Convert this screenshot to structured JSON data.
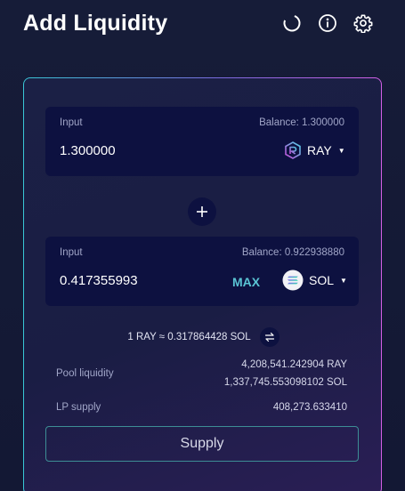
{
  "header": {
    "title": "Add Liquidity"
  },
  "colors": {
    "background": "#141a33",
    "panel": "#0d1140",
    "accent_teal": "#5ac4d4",
    "accent_purple": "#d35fe6",
    "muted_text": "#a1a6c8"
  },
  "icons": {
    "refresh": "refresh-icon",
    "info": "info-icon",
    "settings": "gear-icon"
  },
  "input_a": {
    "label": "Input",
    "balance": "Balance: 1.300000",
    "value": "1.300000",
    "token": "RAY"
  },
  "input_b": {
    "label": "Input",
    "balance": "Balance: 0.922938880",
    "value": "0.417355993",
    "max_label": "MAX",
    "token": "SOL"
  },
  "rate": {
    "text": "1 RAY ≈ 0.317864428 SOL"
  },
  "pool": {
    "liquidity_label": "Pool liquidity",
    "liquidity_ray": "4,208,541.242904 RAY",
    "liquidity_sol": "1,337,745.553098102 SOL",
    "lp_label": "LP supply",
    "lp_value": "408,273.633410"
  },
  "actions": {
    "supply_label": "Supply"
  }
}
